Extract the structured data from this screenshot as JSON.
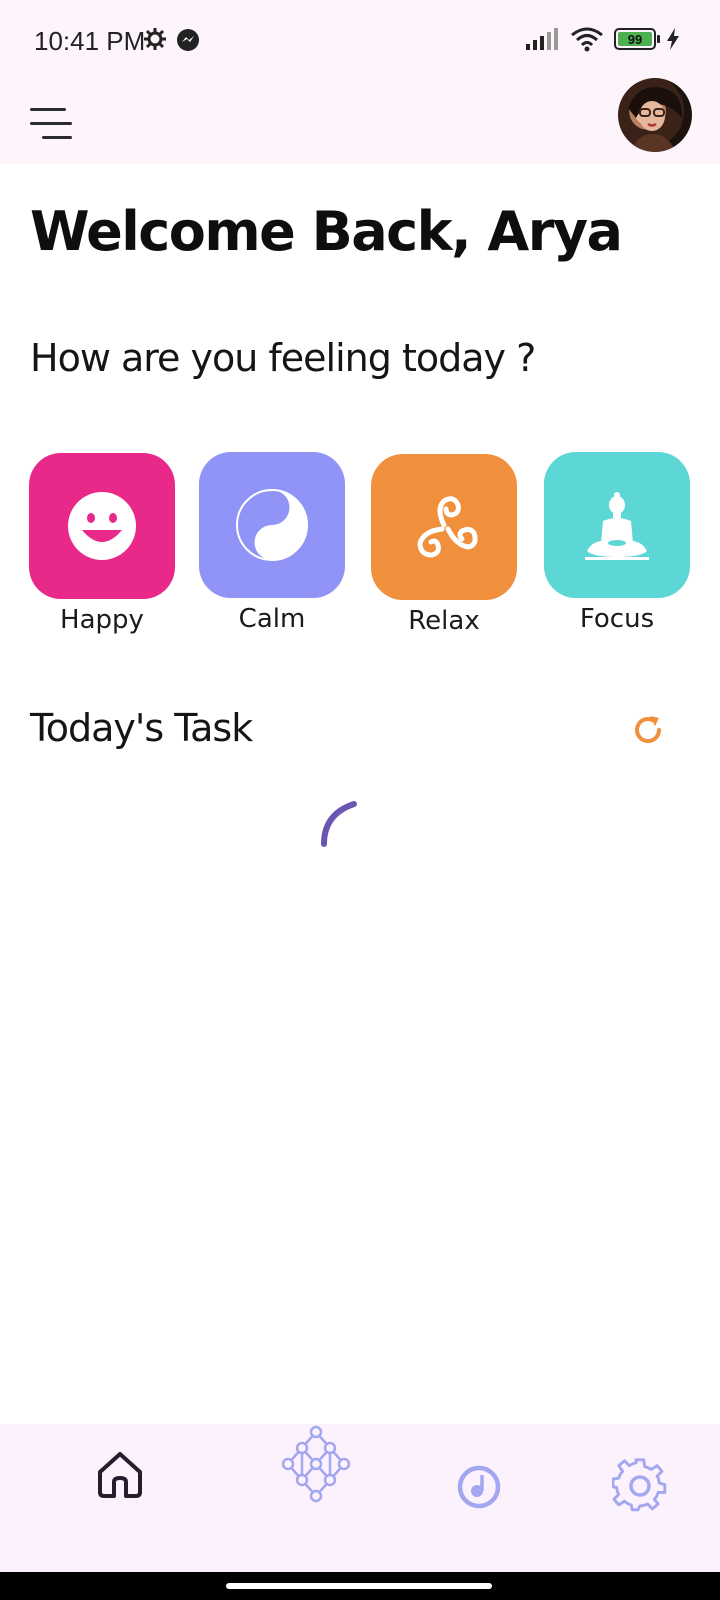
{
  "status_bar": {
    "time": "10:41 PM",
    "icons": [
      "gear-icon",
      "messenger-icon",
      "signal-icon",
      "wifi-icon",
      "battery-icon",
      "charging-icon"
    ],
    "battery_level": "99"
  },
  "app_bar": {
    "menu_icon": "menu-icon",
    "avatar_icon": "profile-avatar"
  },
  "greeting": "Welcome Back, Arya",
  "prompt": "How are you feeling today ?",
  "moods": [
    {
      "label": "Happy",
      "color": "#e9298a",
      "icon": "smiley-icon"
    },
    {
      "label": "Calm",
      "color": "#8f94f6",
      "icon": "yin-yang-icon"
    },
    {
      "label": "Relax",
      "color": "#f0903c",
      "icon": "triskelion-icon"
    },
    {
      "label": "Focus",
      "color": "#5dd6d6",
      "icon": "buddha-icon"
    }
  ],
  "tasks": {
    "title": "Today's Task",
    "refresh_icon": "refresh-icon",
    "refresh_color": "#f0903c",
    "loading_color": "#6a55b5"
  },
  "bottom_nav": {
    "items": [
      {
        "icon": "home-icon",
        "active": true
      },
      {
        "icon": "neural-network-icon",
        "active": false
      },
      {
        "icon": "music-icon",
        "active": false
      },
      {
        "icon": "settings-icon",
        "active": false
      }
    ],
    "active_color": "#2a1a2e",
    "inactive_color": "#a3a6f0"
  }
}
